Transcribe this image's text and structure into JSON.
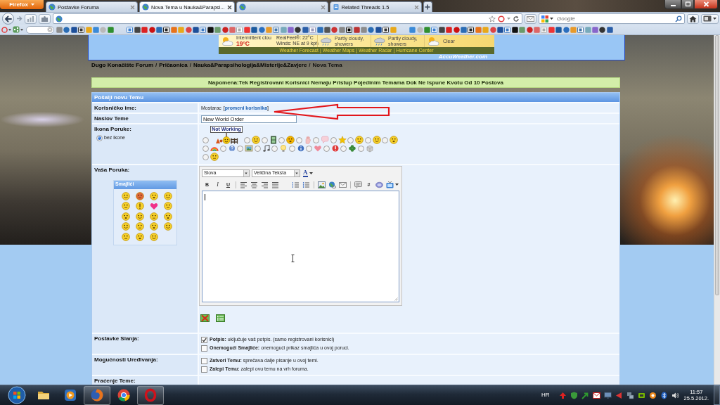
{
  "browser": {
    "menu_button": "Firefox",
    "tabs": [
      {
        "title": "Postavke Foruma",
        "selected": false
      },
      {
        "title": "Nova Tema u Nauka&Parapsi...",
        "selected": true
      },
      {
        "selected": false
      },
      {
        "title": "Related Threads 1.5",
        "selected": false
      }
    ],
    "search": {
      "placeholder": "Google"
    }
  },
  "weather": {
    "condition": "Intermittent clou",
    "realfeel": "RealFeel®: 22°C",
    "temperature": "19°C",
    "wind": "Winds: NE at 9 kph",
    "forecast": [
      "Partly cloudy, showers",
      "Partly cloudy, showers",
      "Clear"
    ],
    "links": [
      "Weather Forecast",
      "Weather Maps",
      "Weather Radar",
      "Hurricane Center"
    ],
    "separator": "|",
    "logo": "AccuWeather.com"
  },
  "breadcrumb": {
    "links": [
      "Dugo Konačište Forum",
      "Pričaonica",
      "Nauka&Parapsihologija&Misterije&Zavjere"
    ],
    "separator": "/",
    "current": "Nova Tema"
  },
  "notice": "Napomena:Tek Registrovani Korisnici Nemaju Pristup Pojedinim Temama Dok Ne Ispune Kvotu Od 10 Postova",
  "form": {
    "title": "Pošalji novu Temu",
    "username": {
      "label": "Korisničko ime:",
      "value": "Mostarac",
      "brackets": [
        "[",
        "]"
      ],
      "link": "promeni korisnika"
    },
    "subject": {
      "label": "Naslov Teme",
      "value": "New World Order"
    },
    "message_icon": {
      "label": "Ikona Poruke:",
      "none_option": {
        "label": "bez ikone",
        "selected": true
      },
      "icon_rows": [
        [
          {
            "sign": "Not Working",
            "selected": false
          },
          {
            "selected": false
          },
          {
            "selected": false
          },
          {
            "selected": false
          },
          {
            "selected": false
          },
          {
            "selected": false
          },
          {
            "selected": false
          },
          {
            "selected": false
          },
          {
            "selected": false
          },
          {
            "selected": false
          }
        ],
        [
          {
            "selected": false
          },
          {
            "selected": false
          },
          {
            "selected": false
          },
          {
            "selected": false
          },
          {
            "selected": false
          },
          {
            "selected": false
          },
          {
            "selected": false
          },
          {
            "selected": false
          },
          {
            "selected": false
          },
          {
            "selected": false
          }
        ],
        [
          {
            "selected": false
          }
        ]
      ]
    },
    "message": {
      "label": "Vaša Poruka:",
      "smilies_title": "Smajlići",
      "font_select": "Slova",
      "size_select": "Veličina Teksta",
      "color_button": "A",
      "toolbar_letters": {
        "bold": "B",
        "italic": "I",
        "underline": "U",
        "code": "#"
      }
    },
    "option_groups": [
      {
        "label": "Postavke Slanja:",
        "options": [
          {
            "text": "**Potpis:** uključuje vaš potpis. (samo registrovani korisnici)",
            "checked": true
          },
          {
            "text": "**Onemogući Smajliće:** onemogući prikaz smajlića u ovoj poruci.",
            "checked": false
          }
        ]
      },
      {
        "label": "Mogućnosti Uređivanja:",
        "options": [
          {
            "text": "**Zatvori Temu:** sprečava dalje pisanje u ovoj temi.",
            "checked": false
          },
          {
            "text": "**Zalepi Temu:** zalepi ovu temu na vrh foruma.",
            "checked": false
          }
        ]
      },
      {
        "label": "Praćenje Teme:"
      }
    ]
  },
  "taskbar": {
    "apps": [
      {
        "running": false
      },
      {
        "running": false
      },
      {
        "running": true
      },
      {
        "running": false
      },
      {
        "running": true
      }
    ],
    "language": "HR",
    "time": "11:57",
    "date": "25.5.2012."
  }
}
